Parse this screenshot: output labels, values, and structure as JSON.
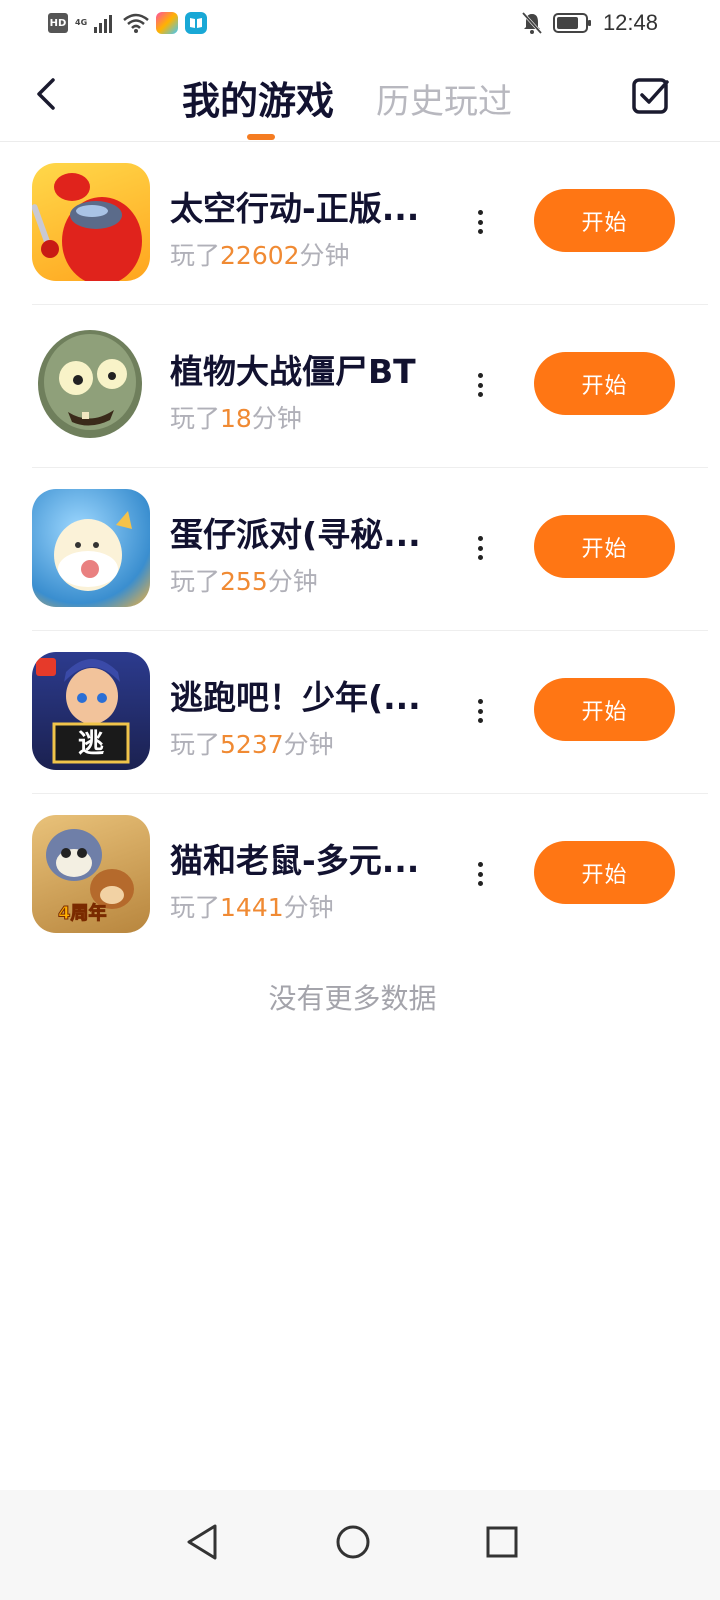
{
  "status_bar": {
    "hd": "HD",
    "network": "4G",
    "time": "12:48"
  },
  "header": {
    "tab_active": "我的游戏",
    "tab_inactive": "历史玩过"
  },
  "games": [
    {
      "title": "太空行动-正版...",
      "played_prefix": "玩了",
      "minutes": "22602",
      "played_suffix": "分钟",
      "button": "开始",
      "icon": "among-us-crewmate-icon"
    },
    {
      "title": "植物大战僵尸BT",
      "played_prefix": "玩了",
      "minutes": "18",
      "played_suffix": "分钟",
      "button": "开始",
      "icon": "zombie-head-icon"
    },
    {
      "title": "蛋仔派对(寻秘...",
      "played_prefix": "玩了",
      "minutes": "255",
      "played_suffix": "分钟",
      "button": "开始",
      "icon": "eggy-party-icon"
    },
    {
      "title": "逃跑吧！少年(...",
      "played_prefix": "玩了",
      "minutes": "5237",
      "played_suffix": "分钟",
      "button": "开始",
      "icon": "run-boy-icon"
    },
    {
      "title": "猫和老鼠-多元...",
      "played_prefix": "玩了",
      "minutes": "1441",
      "played_suffix": "分钟",
      "button": "开始",
      "icon": "tom-and-jerry-icon"
    }
  ],
  "game4_icon_badge": "逃",
  "game5_icon_badge": "4周年",
  "footer_text": "没有更多数据",
  "colors": {
    "accent": "#ff7614",
    "minutes": "#f08a33",
    "title": "#121230",
    "muted": "#b0b0b8"
  }
}
